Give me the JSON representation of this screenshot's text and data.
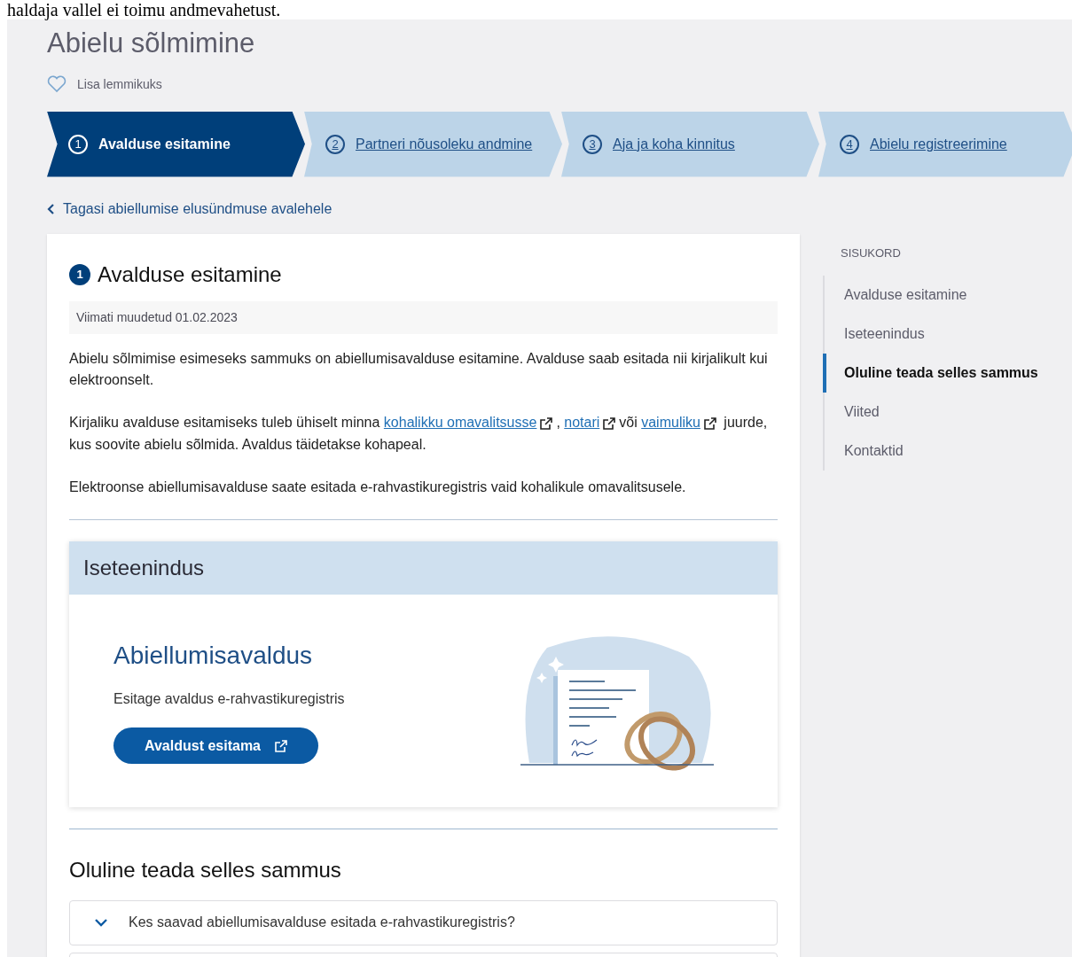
{
  "top_note": "haldaja vallel ei toimu andmevahetust.",
  "page_title": "Abielu sõlmimine",
  "favorite": {
    "label": "Lisa lemmikuks",
    "on": false
  },
  "steps": [
    {
      "number": "1",
      "label": "Avalduse esitamine",
      "selected": true
    },
    {
      "number": "2",
      "label": "Partneri nõusoleku andmine",
      "selected": false
    },
    {
      "number": "3",
      "label": "Aja ja koha kinnitus",
      "selected": false
    },
    {
      "number": "4",
      "label": "Abielu registreerimine",
      "selected": false
    }
  ],
  "back_link": "Tagasi abiellumise elusündmuse avalehele",
  "section": {
    "number": "1",
    "title": "Avalduse esitamine",
    "modified": "Viimati muudetud 01.02.2023",
    "paragraphs": [
      [
        {
          "text": "Abielu sõlmimise esimeseks sammuks on abiellumisavalduse esitamine. Avalduse saab esitada nii kirjalikult kui elektroonselt."
        }
      ],
      [
        {
          "text": "Kirjaliku avalduse esitamiseks tuleb ühiselt minna "
        },
        {
          "link": "kohalikku omavalitsusse"
        },
        {
          "text": ", "
        },
        {
          "link": "notari"
        },
        {
          "text": "või "
        },
        {
          "link": "vaimuliku"
        },
        {
          "text": " juurde, kus soovite abielu sõlmida. Avaldus täidetakse kohapeal."
        }
      ],
      [
        {
          "text": "Elektroonse abiellumisavalduse saate esitada e-rahvastikuregistris vaid kohalikule omavalitsusele."
        }
      ]
    ]
  },
  "self_service": {
    "header": "Iseteenindus",
    "title": "Abiellumisavaldus",
    "description": "Esitage avaldus e-rahvastikuregistris",
    "button": "Avaldust esitama"
  },
  "important": {
    "title": "Oluline teada selles sammus",
    "items": [
      {
        "label": "Kes saavad abiellumisavalduse esitada e-rahvastikuregistris?",
        "expanded": false
      }
    ]
  },
  "toc": {
    "heading": "SISUKORD",
    "items": [
      {
        "label": "Avalduse esitamine",
        "selected": false
      },
      {
        "label": "Iseteenindus",
        "selected": false
      },
      {
        "label": "Oluline teada selles sammus",
        "selected": true
      },
      {
        "label": "Viited",
        "selected": false
      },
      {
        "label": "Kontaktid",
        "selected": false
      }
    ]
  }
}
